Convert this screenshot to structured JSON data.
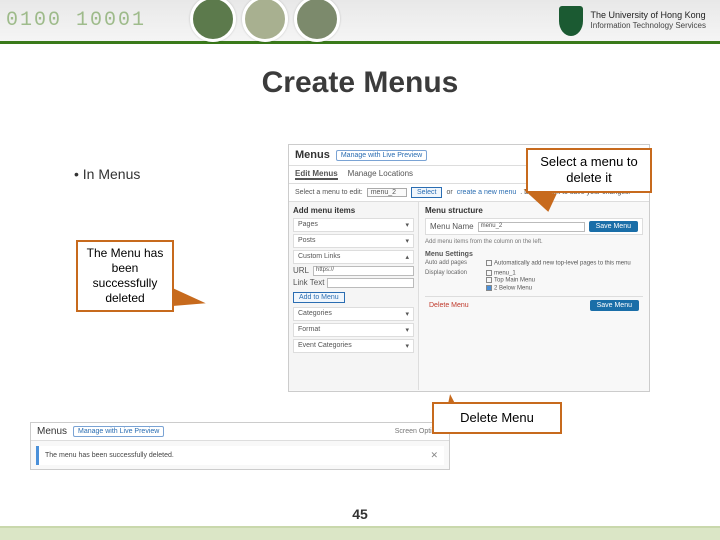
{
  "header": {
    "digits": "0100    10001",
    "uni_line1": "The University of Hong Kong",
    "uni_line2": "Information Technology Services"
  },
  "slide": {
    "title": "Create Menus",
    "bullet": "In Menus",
    "page_number": "45"
  },
  "callouts": {
    "select_menu": "Select a menu to delete it",
    "deleted": "The Menu has been successfully deleted",
    "delete_btn": "Delete Menu"
  },
  "wp": {
    "menus_title": "Menus",
    "live_preview": "Manage with Live Preview",
    "tab_edit": "Edit Menus",
    "tab_locations": "Manage Locations",
    "select_label": "Select a menu to edit:",
    "selected_menu": "menu_2",
    "select_btn": "Select",
    "or": "or",
    "create_new": "create a new menu",
    "dont_forget": ". Don't forget to save your changes!",
    "add_items": "Add menu items",
    "structure": "Menu structure",
    "acc_pages": "Pages",
    "acc_posts": "Posts",
    "acc_custom": "Custom Links",
    "url_label": "URL",
    "url_value": "https://",
    "linktext_label": "Link Text",
    "add_to_menu": "Add to Menu",
    "acc_categories": "Categories",
    "acc_format": "Format",
    "acc_eventcat": "Event Categories",
    "menu_name_label": "Menu Name",
    "menu_name_value": "menu_2",
    "save_menu": "Save Menu",
    "hint": "Add menu items from the column on the left.",
    "menu_settings": "Menu Settings",
    "auto_add": "Auto add pages",
    "auto_add_opt": "Automatically add new top-level pages to this menu",
    "display_loc": "Display location",
    "loc1": "menu_1",
    "loc2": "Top Main Menu",
    "loc3": "2 Below Menu",
    "delete_menu": "Delete Menu",
    "screen_options": "Screen Options",
    "success_msg": "The menu has been successfully deleted.",
    "dismiss": "✕"
  }
}
